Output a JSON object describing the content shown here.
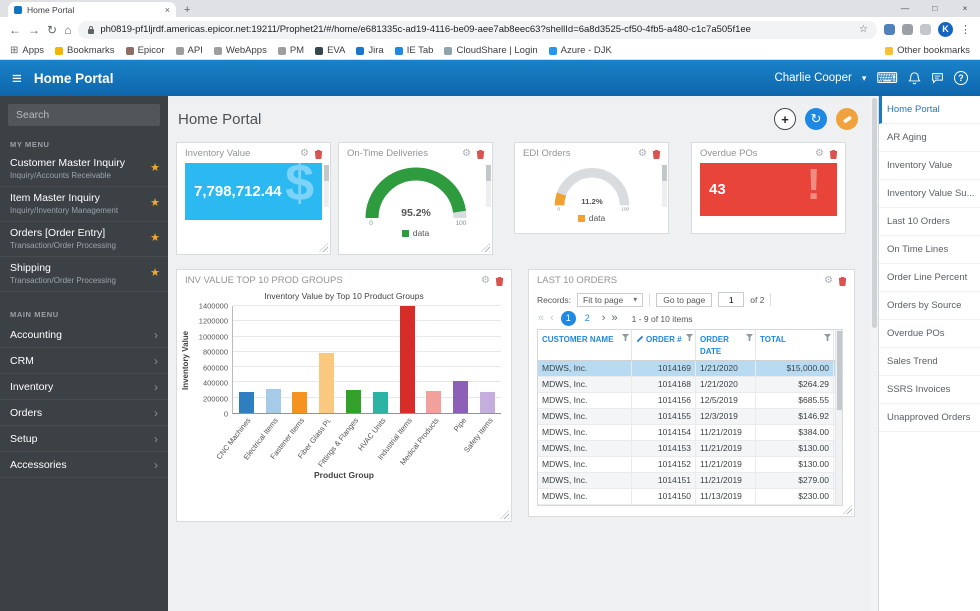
{
  "icons": {
    "hamburger": "≡",
    "caret_down": "▾",
    "star": "★",
    "chevron_right": "›",
    "nav_back": "←",
    "nav_forward": "→",
    "nav_reload": "↻",
    "nav_home": "⌂",
    "bookmark_star": "☆",
    "overflow_dots": "⋮",
    "apps_grid": "⊞",
    "tab_close": "×",
    "new_tab": "+",
    "win_minimize": "—",
    "win_maximize": "□",
    "win_close": "×",
    "gear": "⚙",
    "keyboard": "⌨",
    "add": "+",
    "refresh": "↻",
    "question": "?",
    "pg_first": "«",
    "pg_prev": "‹",
    "pg_next": "›",
    "pg_last": "»"
  },
  "browser": {
    "tab_title": "Home Portal",
    "url": "ph0819-pf1ljrdf.americas.epicor.net:19211/Prophet21/#/home/e681335c-ad19-4116-be09-aee7ab8eec63?shellId=6a8d3525-cf50-4fb5-a480-c1c7a505f1ee",
    "avatar_letter": "K",
    "bookmarks": {
      "apps_label": "Apps",
      "items": [
        {
          "label": "Bookmarks",
          "color": "#f4b400"
        },
        {
          "label": "Epicor",
          "color": "#8d6e63"
        },
        {
          "label": "API",
          "color": "#9e9e9e"
        },
        {
          "label": "WebApps",
          "color": "#9e9e9e"
        },
        {
          "label": "PM",
          "color": "#9e9e9e"
        },
        {
          "label": "EVA",
          "color": "#37474f"
        },
        {
          "label": "Jira",
          "color": "#1976d2"
        },
        {
          "label": "IE Tab",
          "color": "#1e88e5"
        },
        {
          "label": "CloudShare | Login",
          "color": "#90a4ae"
        },
        {
          "label": "Azure - DJK",
          "color": "#2196f3"
        }
      ],
      "other_label": "Other bookmarks"
    }
  },
  "app_header": {
    "title": "Home Portal",
    "user_name": "Charlie Cooper"
  },
  "left_sidebar": {
    "search_placeholder": "Search",
    "my_menu_label": "MY MENU",
    "my_menu": [
      {
        "title": "Customer Master Inquiry",
        "subtitle": "Inquiry/Accounts Receivable"
      },
      {
        "title": "Item Master Inquiry",
        "subtitle": "Inquiry/Inventory Management"
      },
      {
        "title": "Orders [Order Entry]",
        "subtitle": "Transaction/Order Processing"
      },
      {
        "title": "Shipping",
        "subtitle": "Transaction/Order Processing"
      }
    ],
    "main_menu_label": "MAIN MENU",
    "main_menu": [
      "Accounting",
      "CRM",
      "Inventory",
      "Orders",
      "Setup",
      "Accessories"
    ]
  },
  "main": {
    "page_title": "Home Portal",
    "widgets": {
      "inventory_value": {
        "title": "Inventory Value",
        "value": "7,798,712.44",
        "watermark": "$",
        "accent": "#2cb9f2"
      },
      "overdue_pos": {
        "title": "Overdue POs",
        "value": "43",
        "watermark": "!",
        "accent": "#e8443a"
      },
      "prod_groups_title": "INV VALUE TOP 10 PROD GROUPS",
      "last_orders_title": "LAST 10 ORDERS"
    }
  },
  "chart_data": [
    {
      "type": "gauge",
      "title": "On-Time Deliveries",
      "value": 95.2,
      "display_value": "95.2%",
      "range": [
        0,
        100
      ],
      "min_label": "0",
      "max_label": "100",
      "legend": [
        "data"
      ],
      "color": "#2e9b3e",
      "track_color": "#d9dcdf"
    },
    {
      "type": "gauge",
      "title": "EDI Orders",
      "value": 11.2,
      "display_value": "11.2%",
      "range": [
        0,
        100
      ],
      "min_label": "0",
      "max_label": "100",
      "legend": [
        "data"
      ],
      "color": "#f0a12f",
      "track_color": "#d9dcdf"
    },
    {
      "type": "bar",
      "title": "Inventory Value by Top 10 Product Groups",
      "xlabel": "Product Group",
      "ylabel": "Inventory Value",
      "ylim": [
        0,
        1400000
      ],
      "ytick_step": 200000,
      "grid": true,
      "legend_position": "none",
      "categories": [
        "CNC Machines",
        "Electrical Items",
        "Fastener Items",
        "Fiber Glass Pi.",
        "Fittings & Flanges",
        "HVAC Units",
        "Industrial Items",
        "Medical Products",
        "Pipe",
        "Safety Items"
      ],
      "values": [
        270000,
        310000,
        280000,
        780000,
        300000,
        280000,
        1400000,
        290000,
        420000,
        280000
      ],
      "colors": [
        "#2e7fc2",
        "#a6cbe8",
        "#f59321",
        "#fac87e",
        "#33a02c",
        "#2bb3a3",
        "#d62d28",
        "#f2a09b",
        "#8e5fb7",
        "#c5aede"
      ]
    }
  ],
  "orders": {
    "records_label": "Records:",
    "page_size": "Fit to page",
    "go_to_page_label": "Go to page",
    "page_input": "1",
    "of_total": "of 2",
    "pages": [
      "1",
      "2"
    ],
    "active_page_index": 0,
    "range_info": "1 - 9 of 10 items",
    "columns": [
      "CUSTOMER NAME",
      "ORDER #",
      "ORDER DATE",
      "TOTAL"
    ],
    "rows": [
      [
        "MDWS, Inc.",
        "1014169",
        "1/21/2020",
        "$15,000.00"
      ],
      [
        "MDWS, Inc.",
        "1014168",
        "1/21/2020",
        "$264.29"
      ],
      [
        "MDWS, Inc.",
        "1014156",
        "12/5/2019",
        "$685.55"
      ],
      [
        "MDWS, Inc.",
        "1014155",
        "12/3/2019",
        "$146.92"
      ],
      [
        "MDWS, Inc.",
        "1014154",
        "11/21/2019",
        "$384.00"
      ],
      [
        "MDWS, Inc.",
        "1014153",
        "11/21/2019",
        "$130.00"
      ],
      [
        "MDWS, Inc.",
        "1014152",
        "11/21/2019",
        "$130.00"
      ],
      [
        "MDWS, Inc.",
        "1014151",
        "11/21/2019",
        "$279.00"
      ],
      [
        "MDWS, Inc.",
        "1014150",
        "11/13/2019",
        "$230.00"
      ]
    ],
    "selected_row_index": 0
  },
  "right_panel": {
    "items": [
      "Home Portal",
      "AR Aging",
      "Inventory Value",
      "Inventory Value Su...",
      "Last 10 Orders",
      "On Time Lines",
      "Order Line Percent",
      "Orders by Source",
      "Overdue POs",
      "Sales Trend",
      "SSRS Invoices",
      "Unapproved Orders"
    ],
    "active_index": 0
  }
}
